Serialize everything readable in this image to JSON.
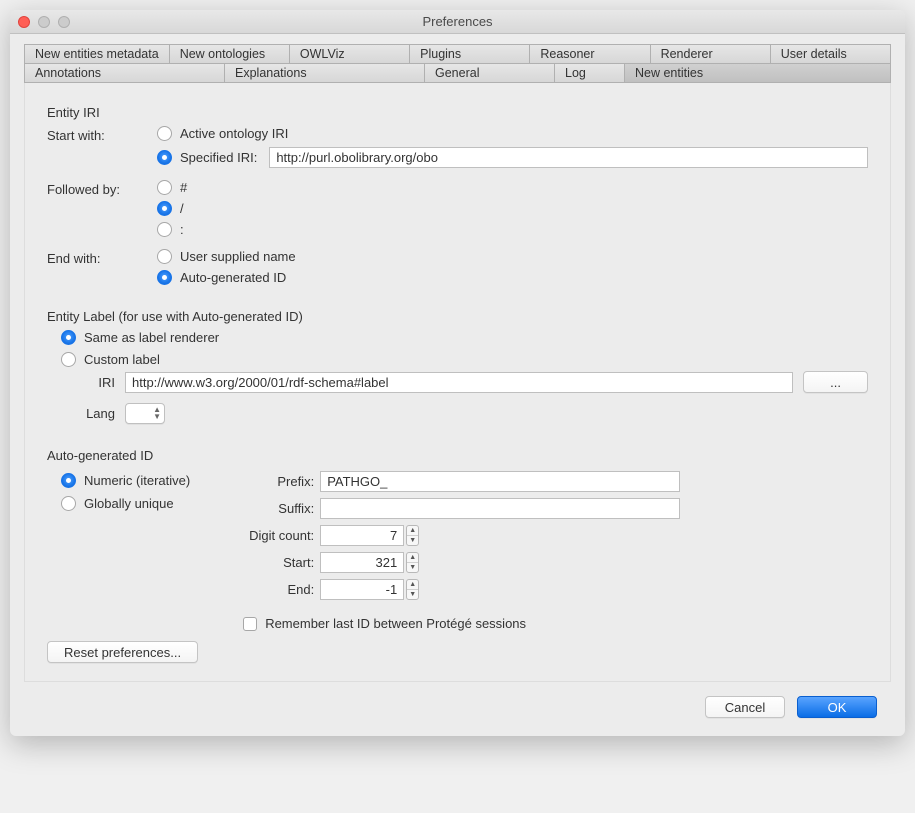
{
  "window": {
    "title": "Preferences"
  },
  "tabs_row1": [
    "New entities metadata",
    "New ontologies",
    "OWLViz",
    "Plugins",
    "Reasoner",
    "Renderer",
    "User details"
  ],
  "tabs_row2": [
    "Annotations",
    "Explanations",
    "General",
    "Log",
    "New entities"
  ],
  "entity_iri": {
    "title": "Entity IRI",
    "start_with_label": "Start with:",
    "active_iri_label": "Active ontology IRI",
    "specified_iri_label": "Specified IRI:",
    "specified_iri_value": "http://purl.obolibrary.org/obo",
    "followed_by_label": "Followed by:",
    "sep_hash": "#",
    "sep_slash": "/",
    "sep_colon": ":",
    "end_with_label": "End with:",
    "user_supplied_label": "User supplied name",
    "auto_id_label": "Auto-generated ID"
  },
  "entity_label": {
    "title": "Entity Label (for use with Auto-generated ID)",
    "same_as_renderer": "Same as label renderer",
    "custom_label": "Custom label",
    "iri_label": "IRI",
    "iri_value": "http://www.w3.org/2000/01/rdf-schema#label",
    "lang_label": "Lang",
    "browse_btn": "..."
  },
  "auto_id": {
    "title": "Auto-generated ID",
    "numeric_label": "Numeric (iterative)",
    "globally_unique_label": "Globally unique",
    "prefix_label": "Prefix:",
    "prefix_value": "PATHGO_",
    "suffix_label": "Suffix:",
    "suffix_value": "",
    "digit_count_label": "Digit count:",
    "digit_count_value": "7",
    "start_label": "Start:",
    "start_value": "321",
    "end_label": "End:",
    "end_value": "-1",
    "remember_label": "Remember last ID between Protégé sessions"
  },
  "buttons": {
    "reset": "Reset preferences...",
    "cancel": "Cancel",
    "ok": "OK"
  }
}
